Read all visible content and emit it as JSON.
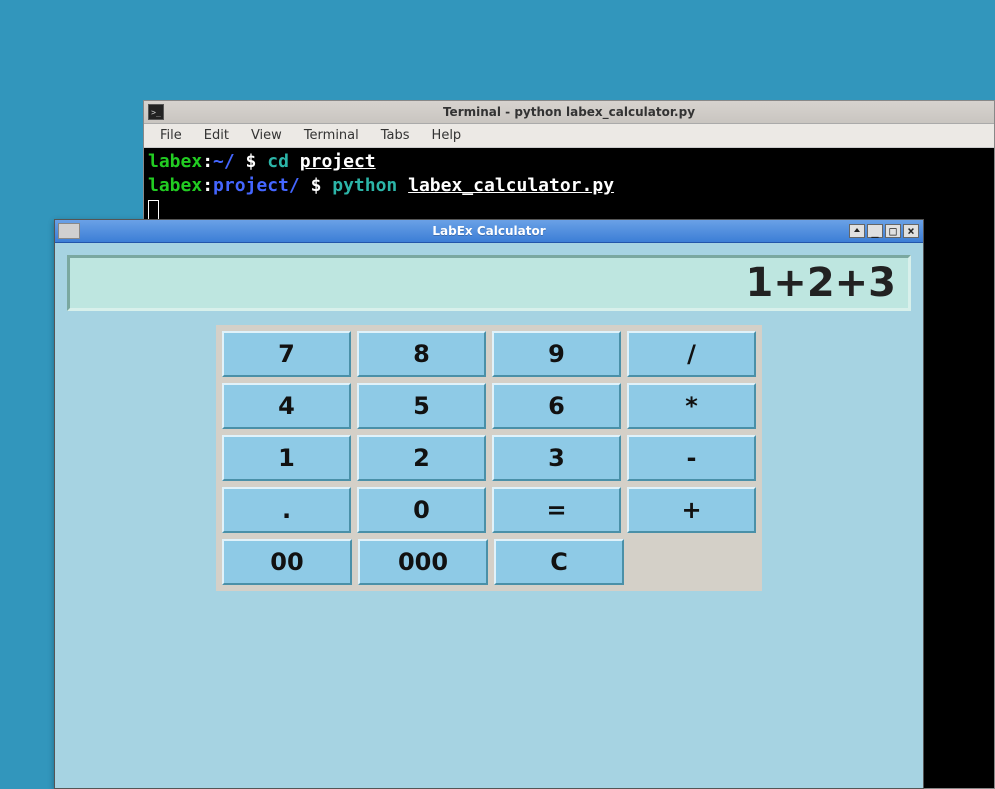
{
  "desktop": {
    "bg_color": "#3296bc"
  },
  "terminal": {
    "title": "Terminal - python labex_calculator.py",
    "menu": [
      "File",
      "Edit",
      "View",
      "Terminal",
      "Tabs",
      "Help"
    ],
    "lines": {
      "l1_host": "labex",
      "l1_colon": ":",
      "l1_path": "~/",
      "l1_prompt": " $ ",
      "l1_cmd": "cd",
      "l1_arg": "project",
      "l2_host": "labex",
      "l2_colon": ":",
      "l2_path": "project/",
      "l2_prompt": " $ ",
      "l2_cmd": "python",
      "l2_arg": "labex_calculator.py"
    }
  },
  "calc": {
    "title": "LabEx Calculator",
    "display": "1+2+3",
    "buttons": [
      [
        "7",
        "8",
        "9",
        "/"
      ],
      [
        "4",
        "5",
        "6",
        "*"
      ],
      [
        "1",
        "2",
        "3",
        "-"
      ],
      [
        ".",
        "0",
        "=",
        "+"
      ],
      [
        "00",
        "000",
        "C",
        ""
      ]
    ]
  }
}
